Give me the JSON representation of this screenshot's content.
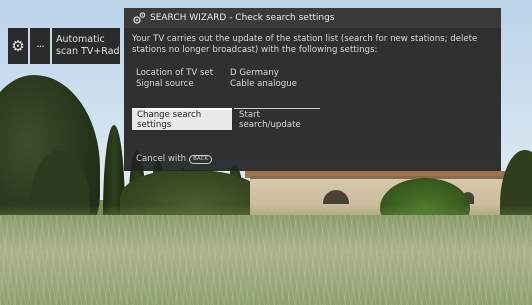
{
  "toolbar": {
    "gear_icon": "gear-icon",
    "more_label": "···",
    "scan_line1": "Automatic",
    "scan_line2": "scan TV+Radio"
  },
  "dialog": {
    "icon": "search-wizard-icon",
    "title": "SEARCH WIZARD - Check search settings",
    "body": "Your TV carries out the update of the station list (search for new stations; delete stations no longer broadcast) with the following settings:",
    "settings": [
      {
        "label": "Location of TV set",
        "value": "D Germany"
      },
      {
        "label": "Signal source",
        "value": "Cable analogue"
      }
    ],
    "buttons": {
      "change": "Change search settings",
      "start": "Start search/update"
    },
    "cancel_text": "Cancel with",
    "cancel_key": "BACK"
  },
  "colors": {
    "dialog_bg": "#222222",
    "header_bg": "#3a3a3a",
    "highlight": "#e9e9e9"
  }
}
